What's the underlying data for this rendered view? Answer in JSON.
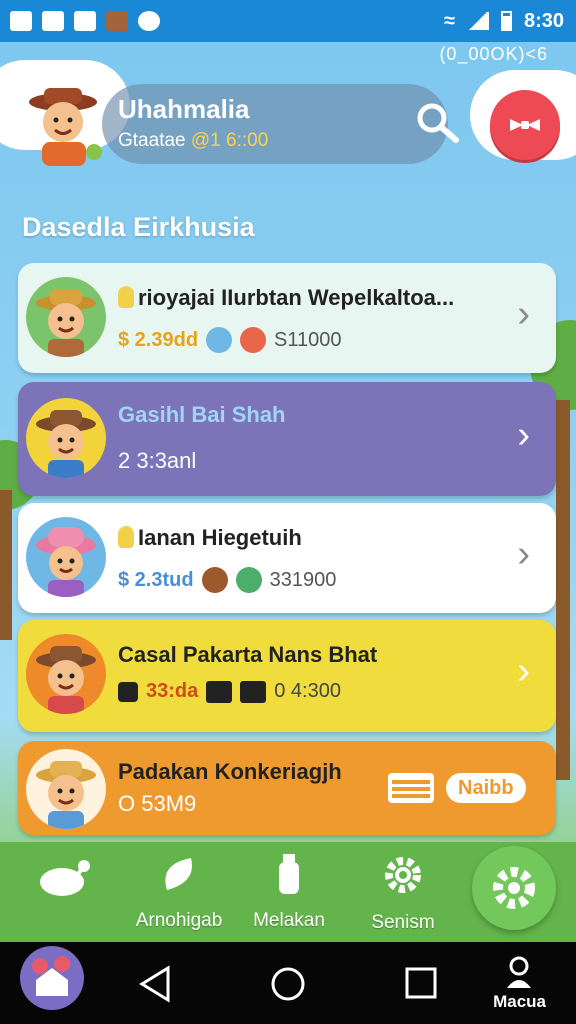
{
  "status_bar": {
    "time": "8:30"
  },
  "header": {
    "top_right_text": "(0_00OK)<6",
    "profile_name": "Uhahmalia",
    "profile_sub_label": "Gtaatae",
    "profile_sub_value": "@1 6::00"
  },
  "section_title": "Dasedla Eirkhusia",
  "cards": [
    {
      "title": "rioyajai IIurbtan Wepelkaltoa...",
      "price": "$ 2.39dd",
      "count": "S11000",
      "bg": "#e8f6f2"
    },
    {
      "title": "Gasihl Bai Shah",
      "price": "2 3:3anl",
      "bg": "#7d73b8"
    },
    {
      "title": "Ianan Hiegetuih",
      "price": "$ 2.3tud",
      "count": "331900",
      "bg": "#ffffff"
    },
    {
      "title": "Casal Pakarta Nans Bhat",
      "price": "33:da",
      "count": "0 4:300",
      "bg": "#f0dc3c"
    },
    {
      "title": "Padakan Konkeriagjh",
      "price": "O 53M9",
      "action_label": "Naibb",
      "bg": "#ee9a2e"
    }
  ],
  "bottom_nav": [
    {
      "label": "",
      "icon": "bird-icon"
    },
    {
      "label": "Arnohigab",
      "icon": "leaf-icon"
    },
    {
      "label": "Melakan",
      "icon": "bottle-icon"
    },
    {
      "label": "Senism",
      "icon": "gear-icon"
    }
  ],
  "system_nav": {
    "label": "Macua"
  },
  "colors": {
    "status_bar": "#1b88d6",
    "red_button": "#ee4a55",
    "nav_green": "#63b44a"
  }
}
